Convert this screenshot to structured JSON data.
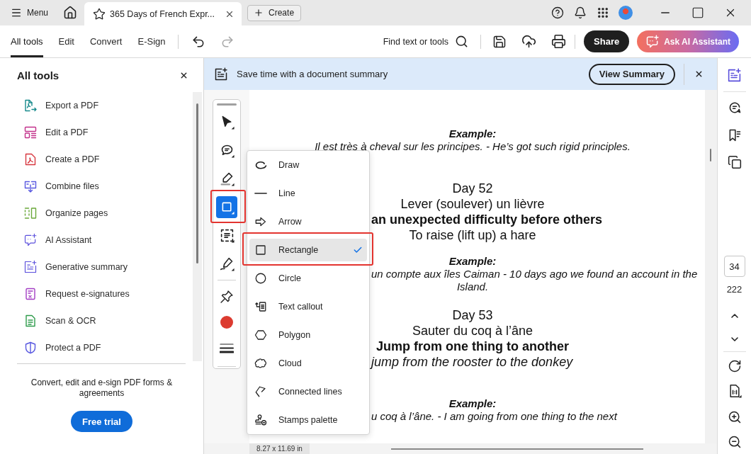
{
  "title_bar": {
    "menu_label": "Menu",
    "document_tab": {
      "title": "365 Days of French Expr..."
    },
    "create_label": "Create"
  },
  "toolbar": {
    "tabs": [
      {
        "label": "All tools",
        "selected": true
      },
      {
        "label": "Edit",
        "selected": false
      },
      {
        "label": "Convert",
        "selected": false
      },
      {
        "label": "E-Sign",
        "selected": false
      }
    ],
    "history": [
      {
        "kind": "undo",
        "disabled": false
      },
      {
        "kind": "redo",
        "disabled": true
      }
    ],
    "find_label": "Find text or tools",
    "share_label": "Share",
    "assistant_label": "Ask AI Assistant"
  },
  "sidebar": {
    "title": "All tools",
    "items": [
      {
        "label": "Export a PDF"
      },
      {
        "label": "Edit a PDF"
      },
      {
        "label": "Create a PDF"
      },
      {
        "label": "Combine files"
      },
      {
        "label": "Organize pages"
      },
      {
        "label": "AI Assistant"
      },
      {
        "label": "Generative summary"
      },
      {
        "label": "Request e-signatures"
      },
      {
        "label": "Scan & OCR"
      },
      {
        "label": "Protect a PDF"
      }
    ],
    "promo_text": "Convert, edit and e-sign PDF forms & agreements",
    "trial_label": "Free trial"
  },
  "summary_banner": {
    "text": "Save time with a document summary",
    "button_label": "View Summary"
  },
  "annotation_toolbar": {
    "upper": [
      {
        "selected": false,
        "highlighted": false
      },
      {
        "selected": false,
        "highlighted": false
      },
      {
        "selected": false,
        "highlighted": false
      },
      {
        "selected": true,
        "highlighted": true
      },
      {
        "selected": false,
        "highlighted": false
      },
      {
        "selected": false,
        "highlighted": false
      }
    ],
    "lower": [
      {
        "kind": "tool",
        "selected": false
      },
      {
        "kind": "swatch",
        "color": "#dc3b30"
      },
      {
        "kind": "tool",
        "selected": false
      }
    ]
  },
  "shape_menu": {
    "items": [
      {
        "label": "Draw",
        "selected": false,
        "highlighted": false
      },
      {
        "label": "Line",
        "selected": false,
        "highlighted": false
      },
      {
        "label": "Arrow",
        "selected": false,
        "highlighted": false
      },
      {
        "label": "Rectangle",
        "selected": true,
        "highlighted": true
      },
      {
        "label": "Circle",
        "selected": false,
        "highlighted": false
      },
      {
        "label": "Text callout",
        "selected": false,
        "highlighted": false
      },
      {
        "label": "Polygon",
        "selected": false,
        "highlighted": false
      },
      {
        "label": "Cloud",
        "selected": false,
        "highlighted": false
      },
      {
        "label": "Connected lines",
        "selected": false,
        "highlighted": false
      },
      {
        "label": "Stamps palette",
        "selected": false,
        "highlighted": false
      }
    ]
  },
  "document": {
    "lines": [
      {
        "kind": "label",
        "text": "Example:",
        "hidden_start": false
      },
      {
        "kind": "example",
        "text": "Il est très à cheval sur les principes. - He’s got such rigid principles.",
        "hidden_start": false
      },
      {
        "kind": "heading",
        "text": "Day 52",
        "hidden_start": false
      },
      {
        "kind": "heading",
        "text": "Lever (soulever) un lièvre",
        "hidden_start": false
      },
      {
        "kind": "meaning",
        "text": "an unexpected difficulty before others",
        "hidden_start": true
      },
      {
        "kind": "heading",
        "text": "To raise (lift up) a hare",
        "hidden_start": false
      },
      {
        "kind": "label",
        "text": "Example:",
        "hidden_start": false
      },
      {
        "kind": "example",
        "text": "un compte aux îles Caiman - 10 days ago we found an account in the",
        "hidden_start": true
      },
      {
        "kind": "example",
        "text": "Island.",
        "hidden_start": false
      },
      {
        "kind": "heading",
        "text": "Day 53",
        "hidden_start": false
      },
      {
        "kind": "heading",
        "text": "Sauter du coq à l’âne",
        "hidden_start": false
      },
      {
        "kind": "meaning",
        "text": "Jump from one thing to another",
        "hidden_start": false
      },
      {
        "kind": "literal",
        "text": "jump from the rooster to the donkey",
        "hidden_start": true
      },
      {
        "kind": "label",
        "text": "Example:",
        "hidden_start": false
      },
      {
        "kind": "example",
        "text": "u coq à l’âne. - I am going from one thing to the next",
        "hidden_start": true
      }
    ],
    "page_size": "8.27 x 11.69 in"
  },
  "page_navigation": {
    "current_page": "34",
    "page_count": "222"
  }
}
